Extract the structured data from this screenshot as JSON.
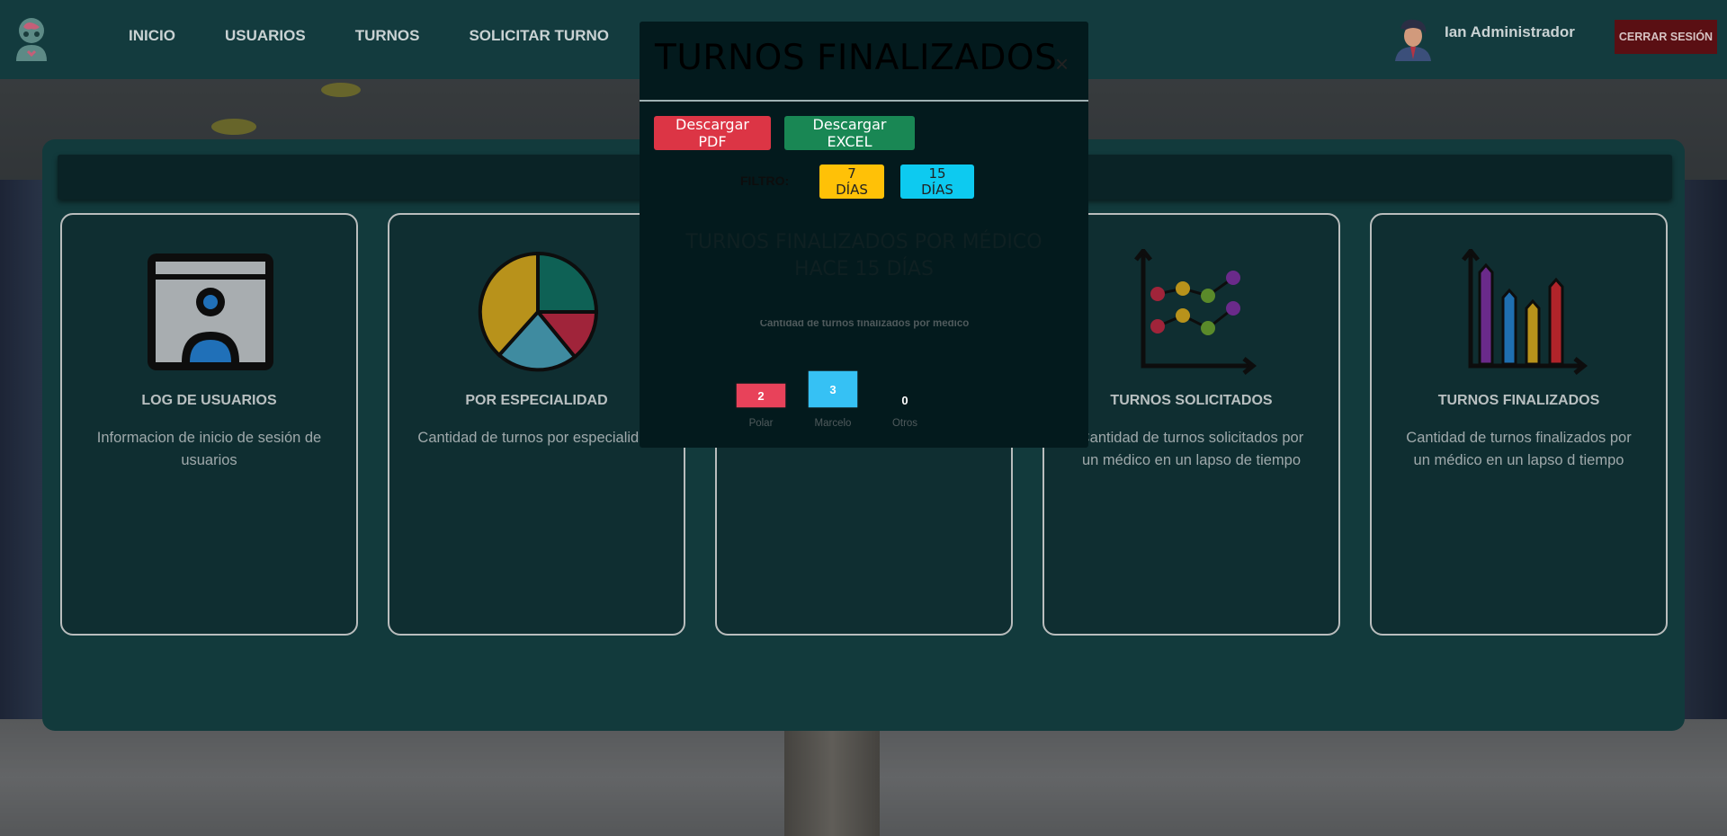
{
  "nav": {
    "links": [
      "INICIO",
      "USUARIOS",
      "TURNOS",
      "SOLICITAR TURNO"
    ],
    "user_name": "Ian Administrador",
    "logout_label": "CERRAR SESIÓN"
  },
  "cards": [
    {
      "title": "LOG DE USUARIOS",
      "desc": "Informacion de inicio de sesión de usuarios"
    },
    {
      "title": "POR ESPECIALIDAD",
      "desc": "Cantidad de turnos por especialidad"
    },
    {
      "title": "",
      "desc": ""
    },
    {
      "title": "TURNOS SOLICITADOS",
      "desc": "Cantidad de turnos solicitados por un médico en un lapso de tiempo"
    },
    {
      "title": "TURNOS FINALIZADOS",
      "desc": "Cantidad de turnos finalizados por un médico en un lapso d tiempo"
    }
  ],
  "modal": {
    "title": "TURNOS FINALIZADOS",
    "close_icon": "×",
    "pdf_label": "Descargar PDF",
    "excel_label": "Descargar EXCEL",
    "filter_label": "FILTRO:",
    "filter_7": "7 DÍAS",
    "filter_15": "15 DÍAS",
    "heading_line1": "TURNOS FINALIZADOS POR MÉDICO",
    "heading_line2": "HACE 15 DÍAS"
  },
  "colors": {
    "navbar": "#133b3e",
    "panel": "#123a3c",
    "card": "#0f2e31",
    "logout": "#5a0f13",
    "pdf": "#dc3545",
    "excel": "#198754",
    "filter7": "#ffc107",
    "filter15": "#0dcaf0"
  },
  "chart_data": {
    "type": "bar",
    "title": "Cantidad de turnos finalizados por médico",
    "categories": [
      "Polar",
      "Marcelo",
      "Otros"
    ],
    "values": [
      2,
      3,
      0
    ],
    "colors": [
      "#e8425a",
      "#36c1f4",
      "#ffffff"
    ],
    "y_ticks": [
      "2",
      "0"
    ],
    "ylim": [
      0,
      3
    ]
  }
}
